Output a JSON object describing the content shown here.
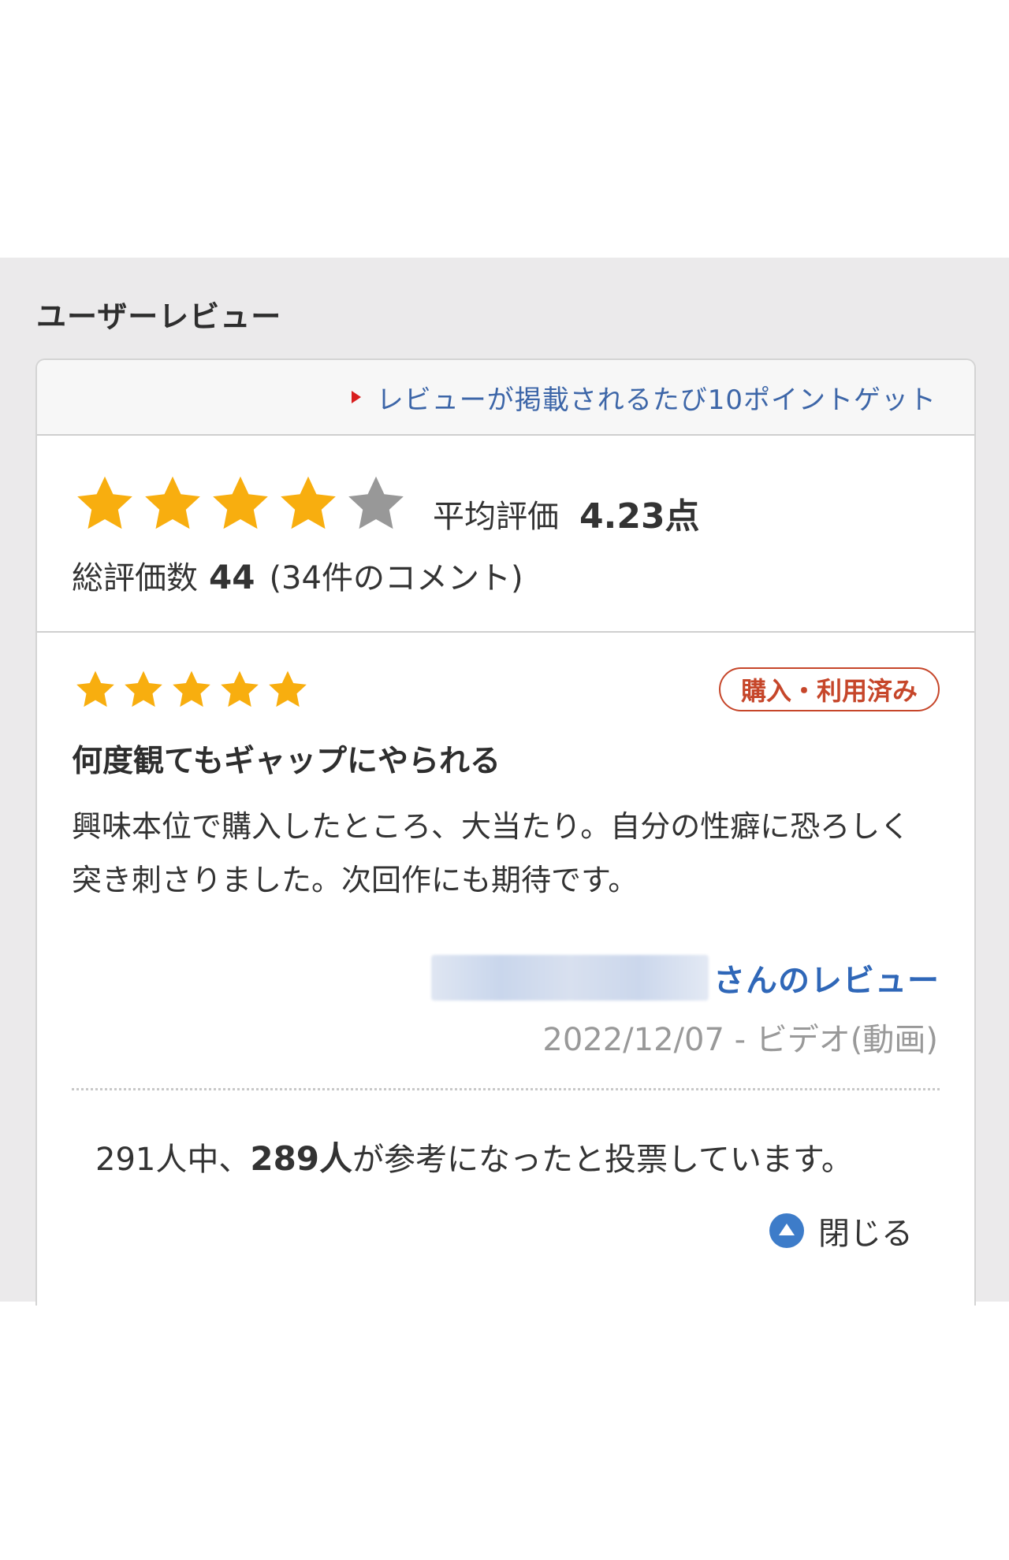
{
  "section": {
    "title": "ユーザーレビュー"
  },
  "notice": {
    "text": "レビューが掲載されるたび10ポイントゲット"
  },
  "summary": {
    "rating_stars": 4,
    "max_stars": 5,
    "avg_label": "平均評価",
    "avg_value": "4.23点",
    "total_label": "総評価数",
    "total_count": "44",
    "comment_count": "(34件のコメント)"
  },
  "review": {
    "rating_stars": 5,
    "badge": "購入・利用済み",
    "title": "何度観てもギャップにやられる",
    "body": "興味本位で購入したところ、大当たり。自分の性癖に恐ろしく突き刺さりました。次回作にも期待です。",
    "reviewer_suffix": "さんのレビュー",
    "meta": "2022/12/07 - ビデオ(動画)",
    "helpful_prefix": "291人中、",
    "helpful_count": "289人",
    "helpful_suffix": "が参考になったと投票しています。",
    "close_label": "閉じる"
  },
  "colors": {
    "star_filled": "#f8ae0f",
    "star_empty": "#989898",
    "link": "#3d66a8",
    "badge": "#c6462a",
    "section_bg": "#ebeaeb"
  }
}
